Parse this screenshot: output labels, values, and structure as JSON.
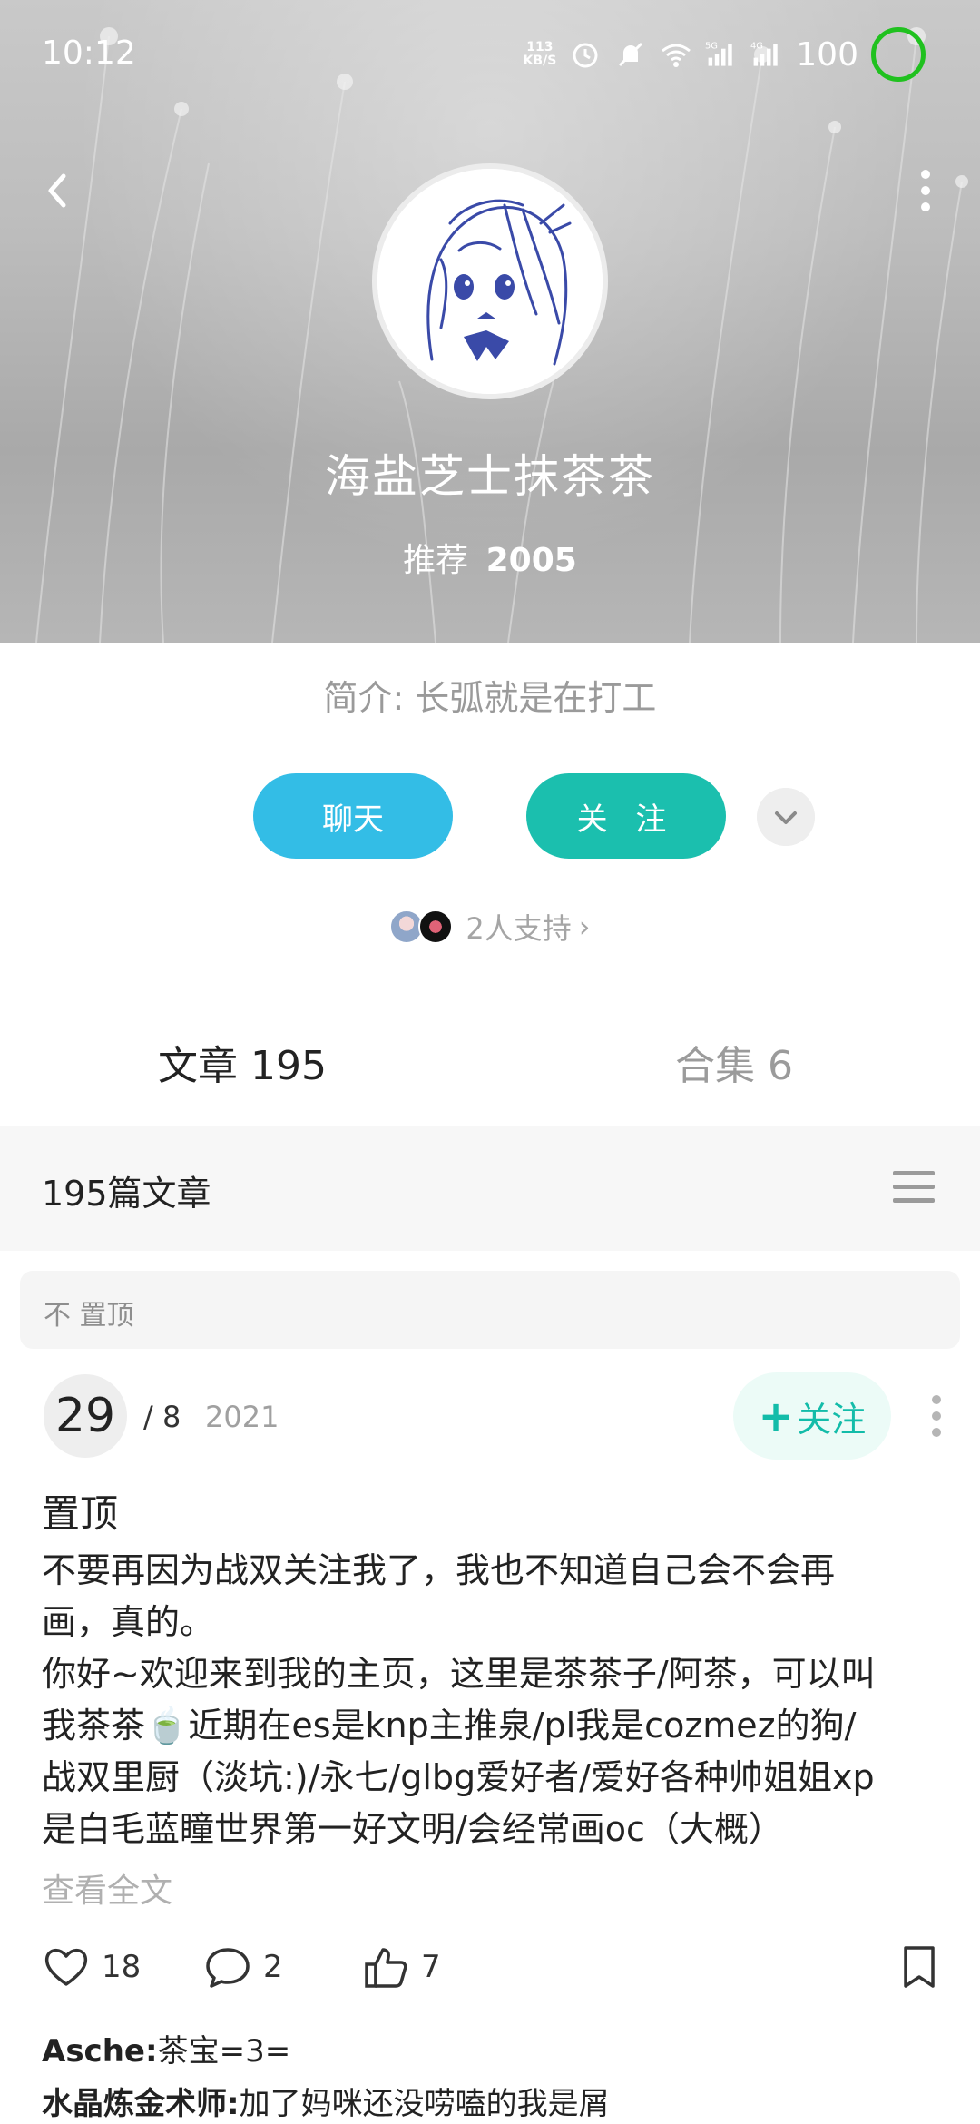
{
  "status": {
    "time": "10:12",
    "net_speed_value": "113",
    "net_speed_unit": "KB/S",
    "signal1": "5G",
    "signal2": "4G",
    "battery": "100"
  },
  "profile": {
    "name": "海盐芝士抹茶茶",
    "recommend_label": "推荐",
    "recommend_count": "2005",
    "bio": "简介: 长弧就是在打工"
  },
  "actions": {
    "chat_label": "聊天",
    "follow_label": "关 注"
  },
  "support": {
    "text": "2人支持",
    "arrow": "›"
  },
  "tabs": [
    {
      "label": "文章 195"
    },
    {
      "label": "合集 6"
    }
  ],
  "section": {
    "title": "195篇文章"
  },
  "pinned": {
    "label": "不 置顶"
  },
  "post": {
    "day": "29",
    "month": "/ 8",
    "year": "2021",
    "follow_label": "关注",
    "title": "置顶",
    "body_lines": [
      "不要再因为战双关注我了，我也不知道自己会不会再",
      "画，真的。",
      "你好~欢迎来到我的主页，这里是茶茶子/阿茶，可以叫",
      "我茶茶🍵近期在es是knp主推泉/pl我是cozmez的狗/",
      "战双里厨（淡坑:)/永七/glbg爱好者/爱好各种帅姐姐xp",
      "是白毛蓝瞳世界第一好文明/会经常画oc（大概）"
    ],
    "read_more": "查看全文",
    "likes": "18",
    "comments_count": "2",
    "recommends": "7"
  },
  "comments": [
    {
      "user": "Asche:",
      "text": "茶宝=3="
    },
    {
      "user": "水晶炼金术师:",
      "text": "加了妈咪还没唠嗑的我是屑"
    }
  ]
}
